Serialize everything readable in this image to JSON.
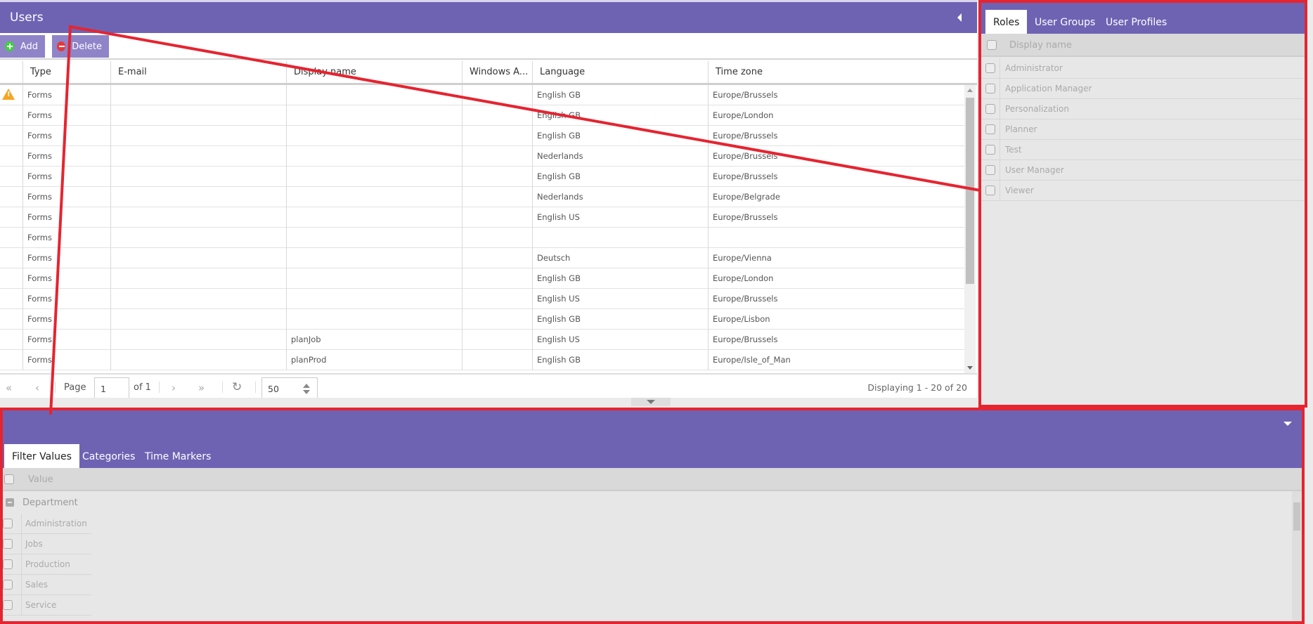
{
  "users_panel": {
    "title": "Users",
    "toolbar": {
      "add_label": "Add",
      "delete_label": "Delete"
    },
    "columns": [
      "",
      "Type",
      "E-mail",
      "Display name",
      "Windows A...",
      "Language",
      "Time zone"
    ],
    "rows": [
      {
        "warning": true,
        "type": "Forms",
        "email": "",
        "display_name": "",
        "windows": "",
        "language": "English GB",
        "timezone": "Europe/Brussels"
      },
      {
        "warning": false,
        "type": "Forms",
        "email": "",
        "display_name": "",
        "windows": "",
        "language": "English GB",
        "timezone": "Europe/London"
      },
      {
        "warning": false,
        "type": "Forms",
        "email": "",
        "display_name": "",
        "windows": "",
        "language": "English GB",
        "timezone": "Europe/Brussels"
      },
      {
        "warning": false,
        "type": "Forms",
        "email": "",
        "display_name": "",
        "windows": "",
        "language": "Nederlands",
        "timezone": "Europe/Brussels"
      },
      {
        "warning": false,
        "type": "Forms",
        "email": "",
        "display_name": "",
        "windows": "",
        "language": "English GB",
        "timezone": "Europe/Brussels"
      },
      {
        "warning": false,
        "type": "Forms",
        "email": "",
        "display_name": "",
        "windows": "",
        "language": "Nederlands",
        "timezone": "Europe/Belgrade"
      },
      {
        "warning": false,
        "type": "Forms",
        "email": "",
        "display_name": "",
        "windows": "",
        "language": "English US",
        "timezone": "Europe/Brussels"
      },
      {
        "warning": false,
        "type": "Forms",
        "email": "",
        "display_name": "",
        "windows": "",
        "language": "",
        "timezone": ""
      },
      {
        "warning": false,
        "type": "Forms",
        "email": "",
        "display_name": "",
        "windows": "",
        "language": "Deutsch",
        "timezone": "Europe/Vienna"
      },
      {
        "warning": false,
        "type": "Forms",
        "email": "",
        "display_name": "",
        "windows": "",
        "language": "English GB",
        "timezone": "Europe/London"
      },
      {
        "warning": false,
        "type": "Forms",
        "email": "",
        "display_name": "",
        "windows": "",
        "language": "English US",
        "timezone": "Europe/Brussels"
      },
      {
        "warning": false,
        "type": "Forms",
        "email": "",
        "display_name": "",
        "windows": "",
        "language": "English GB",
        "timezone": "Europe/Lisbon"
      },
      {
        "warning": false,
        "type": "Forms",
        "email": "",
        "display_name": "planJob",
        "windows": "",
        "language": "English US",
        "timezone": "Europe/Brussels"
      },
      {
        "warning": false,
        "type": "Forms",
        "email": "",
        "display_name": "planProd",
        "windows": "",
        "language": "English GB",
        "timezone": "Europe/Isle_of_Man"
      }
    ],
    "pager": {
      "page_label": "Page",
      "page_value": "1",
      "of_label": "of 1",
      "page_size": "50",
      "display_info": "Displaying 1 - 20 of 20"
    }
  },
  "roles_panel": {
    "tabs": [
      "Roles",
      "User Groups",
      "User Profiles"
    ],
    "active_tab": "Roles",
    "header": "Display name",
    "items": [
      "Administrator",
      "Application Manager",
      "Personalization",
      "Planner",
      "Test",
      "User Manager",
      "Viewer"
    ]
  },
  "filter_panel": {
    "tabs": [
      "Filter Values",
      "Categories",
      "Time Markers"
    ],
    "active_tab": "Filter Values",
    "header": "Value",
    "group": "Department",
    "items": [
      "Administration",
      "Jobs",
      "Production",
      "Sales",
      "Service"
    ]
  },
  "colors": {
    "header_purple": "#6e63b3",
    "button_purple": "#8f84c8",
    "annotation_red": "#e52430",
    "warning_orange": "#f5a623",
    "add_green": "#3fcf3f",
    "delete_red": "#e03a3a"
  }
}
